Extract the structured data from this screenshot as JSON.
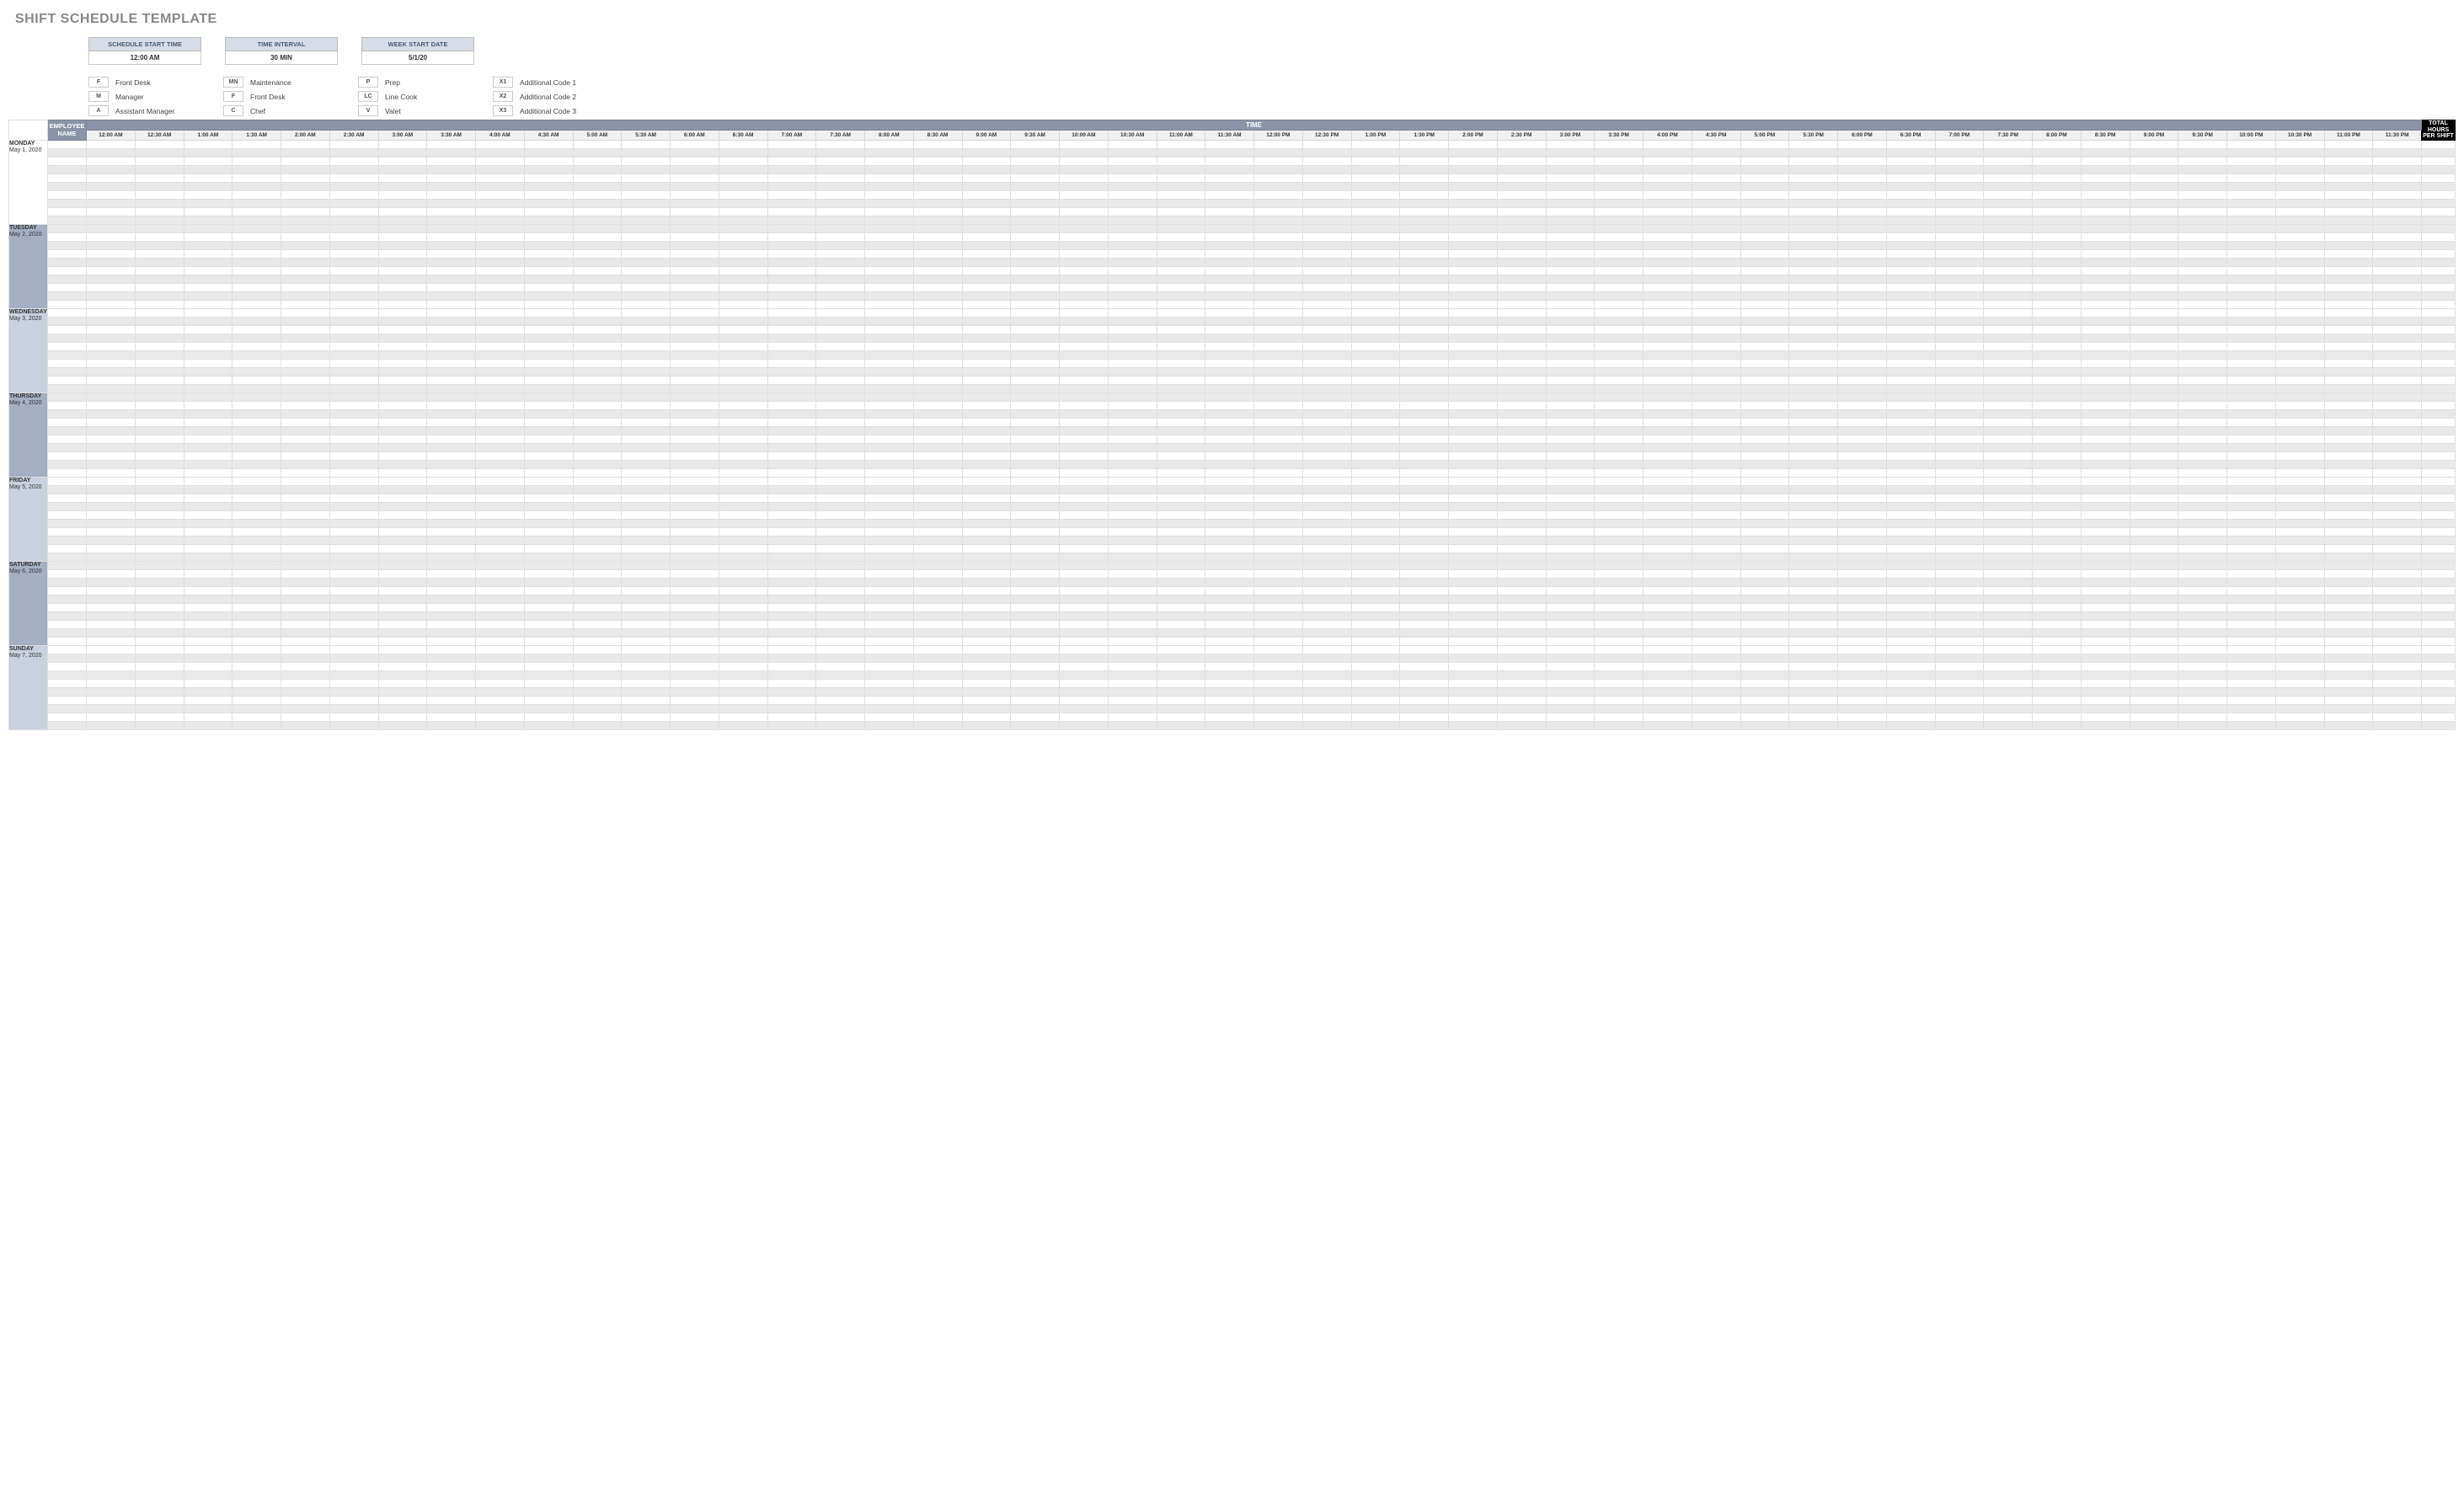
{
  "title": "SHIFT SCHEDULE TEMPLATE",
  "config": {
    "start_time": {
      "header": "SCHEDULE START TIME",
      "value": "12:00 AM"
    },
    "interval": {
      "header": "TIME INTERVAL",
      "value": "30 MIN"
    },
    "week_start": {
      "header": "WEEK START DATE",
      "value": "5/1/20"
    }
  },
  "codes": {
    "col1": [
      {
        "code": "F",
        "label": "Front Desk"
      },
      {
        "code": "M",
        "label": "Manager"
      },
      {
        "code": "A",
        "label": "Assistant Manager"
      }
    ],
    "col2": [
      {
        "code": "MN",
        "label": "Maintenance"
      },
      {
        "code": "F",
        "label": "Front Desk"
      },
      {
        "code": "C",
        "label": "Chef"
      }
    ],
    "col3": [
      {
        "code": "P",
        "label": "Prep"
      },
      {
        "code": "LC",
        "label": "Line Cook"
      },
      {
        "code": "V",
        "label": "Valet"
      }
    ],
    "col4": [
      {
        "code": "X1",
        "label": "Additional Code 1"
      },
      {
        "code": "X2",
        "label": "Additional Code 2"
      },
      {
        "code": "X3",
        "label": "Additional Code 3"
      }
    ]
  },
  "headers": {
    "employee": "EMPLOYEE NAME",
    "time": "TIME",
    "total_l1": "TOTAL HOURS",
    "total_l2": "PER SHIFT"
  },
  "time_slots": [
    "12:00 AM",
    "12:30 AM",
    "1:00 AM",
    "1:30 AM",
    "2:00 AM",
    "2:30 AM",
    "3:00 AM",
    "3:30 AM",
    "4:00 AM",
    "4:30 AM",
    "5:00 AM",
    "5:30 AM",
    "6:00 AM",
    "6:30 AM",
    "7:00 AM",
    "7:30 AM",
    "8:00 AM",
    "8:30 AM",
    "9:00 AM",
    "9:30 AM",
    "10:00 AM",
    "10:30 AM",
    "11:00 AM",
    "11:30 AM",
    "12:00 PM",
    "12:30 PM",
    "1:00 PM",
    "1:30 PM",
    "2:00 PM",
    "2:30 PM",
    "3:00 PM",
    "3:30 PM",
    "4:00 PM",
    "4:30 PM",
    "5:00 PM",
    "5:30 PM",
    "6:00 PM",
    "6:30 PM",
    "7:00 PM",
    "7:30 PM",
    "8:00 PM",
    "8:30 PM",
    "9:00 PM",
    "9:30 PM",
    "10:00 PM",
    "10:30 PM",
    "11:00 PM",
    "11:30 PM"
  ],
  "days": [
    {
      "name": "MONDAY",
      "date": "May 1, 2020",
      "shade": "white",
      "rows": 10
    },
    {
      "name": "TUESDAY",
      "date": "May 2, 2020",
      "shade": "dark",
      "rows": 10
    },
    {
      "name": "WEDNESDAY",
      "date": "May 3, 2020",
      "shade": "blue",
      "rows": 10
    },
    {
      "name": "THURSDAY",
      "date": "May 4, 2020",
      "shade": "dark",
      "rows": 10
    },
    {
      "name": "FRIDAY",
      "date": "May 5, 2020",
      "shade": "blue",
      "rows": 10
    },
    {
      "name": "SATURDAY",
      "date": "May 6, 2020",
      "shade": "dark",
      "rows": 10
    },
    {
      "name": "SUNDAY",
      "date": "May 7, 2020",
      "shade": "blue",
      "rows": 10
    }
  ]
}
